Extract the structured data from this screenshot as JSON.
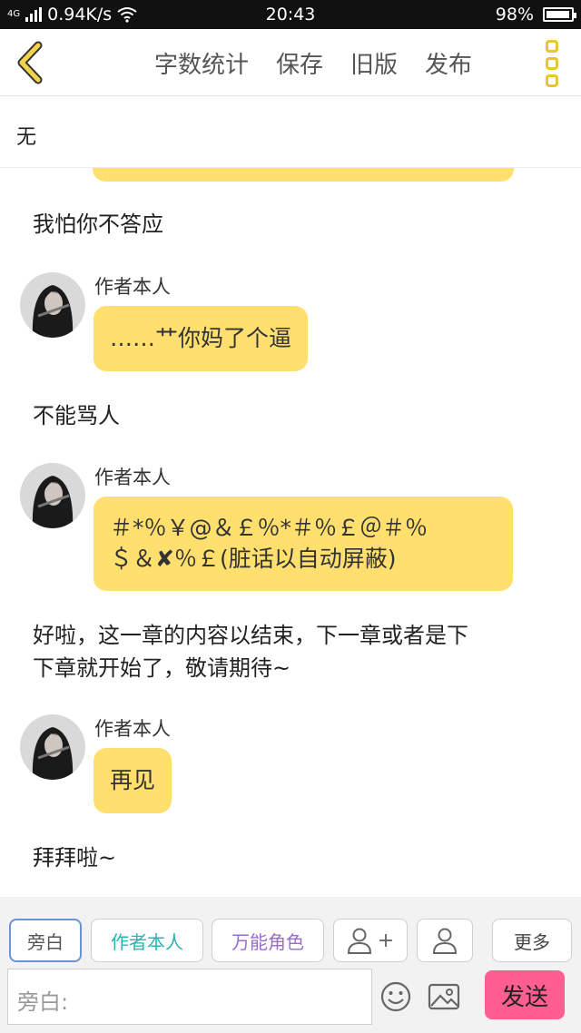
{
  "status_bar": {
    "network": "4G",
    "speed": "0.94K/s",
    "time": "20:43",
    "battery": "98%",
    "battery_level": 0.98
  },
  "top_bar": {
    "actions": [
      "字数统计",
      "保存",
      "旧版",
      "发布"
    ]
  },
  "chapter_title": "无",
  "chat": {
    "narration_1": "我怕你不答应",
    "message_1": {
      "speaker": "作者本人",
      "text": "……艹你妈了个逼"
    },
    "narration_2": "不能骂人",
    "message_2": {
      "speaker": "作者本人",
      "line1": "＃*％￥@＆￡％*＃％￡＠＃％",
      "line2": "＄＆✘％￡(脏话以自动屏蔽)"
    },
    "narration_3_line1": "好啦，这一章的内容以结束，下一章或者是下",
    "narration_3_line2": "下章就开始了，敬请期待~",
    "message_3": {
      "speaker": "作者本人",
      "text": "再见"
    },
    "narration_4": "拜拜啦~"
  },
  "bottom_bar": {
    "roles": [
      "旁白",
      "作者本人",
      "万能角色"
    ],
    "role_colors": [
      "#555555",
      "#2bb3b0",
      "#9a6bd3"
    ],
    "add_role_plus": "+",
    "more_label": "更多",
    "input_placeholder": "旁白:",
    "send_label": "发送",
    "send_color": "#ff5f90"
  },
  "accent_color": "#ffdf6e"
}
